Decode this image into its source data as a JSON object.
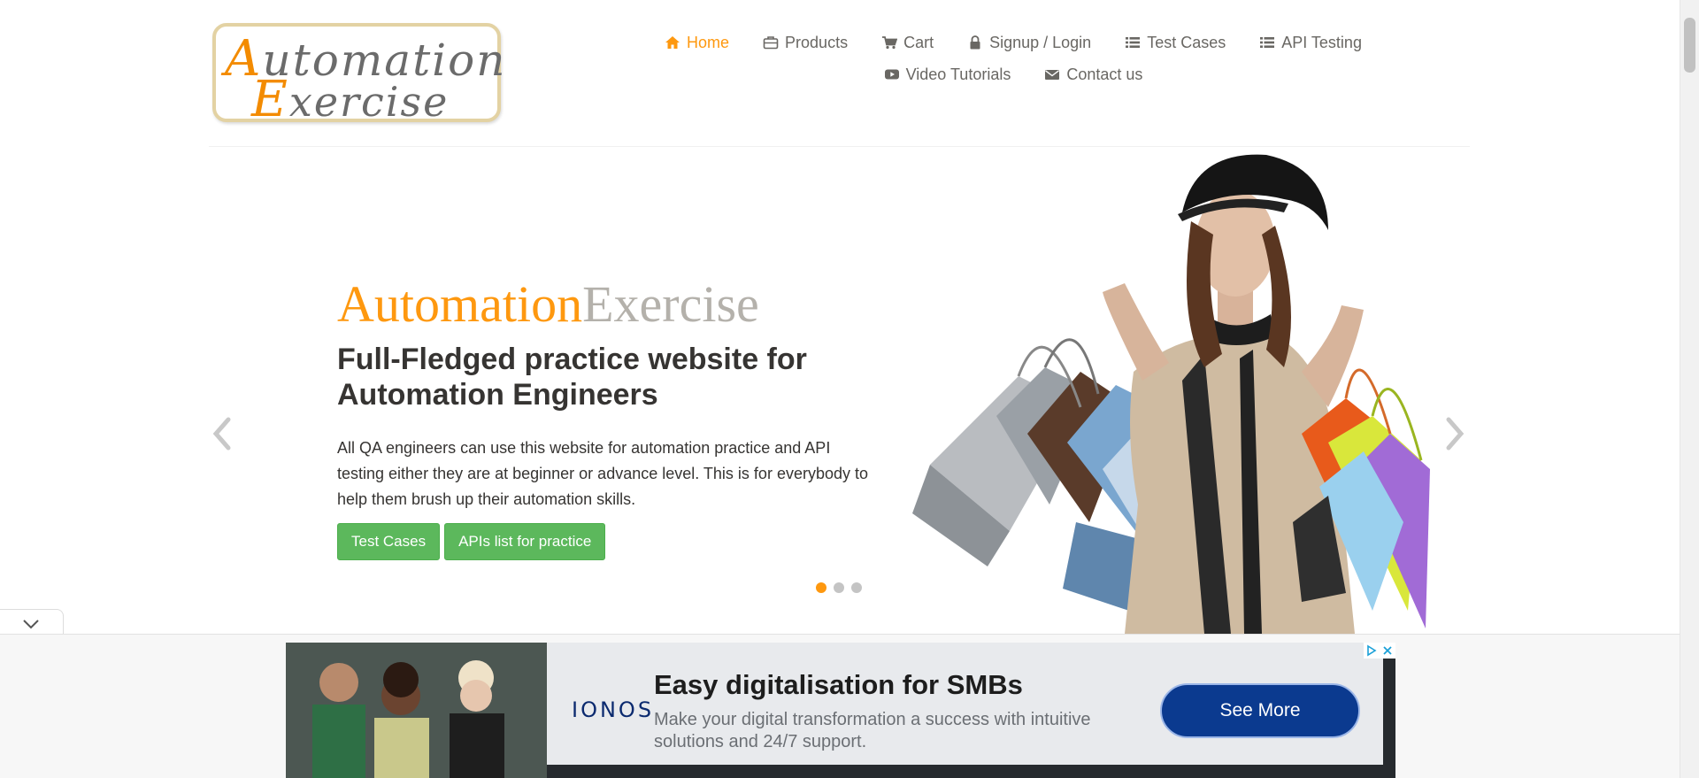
{
  "logo": {
    "line1_cap": "A",
    "line1_rest": "utomation",
    "line2_cap": "E",
    "line2_rest": "xercise"
  },
  "nav": {
    "row1": [
      {
        "label": "Home",
        "icon": "home-icon",
        "active": true
      },
      {
        "label": "Products",
        "icon": "briefcase-icon",
        "active": false
      },
      {
        "label": "Cart",
        "icon": "cart-icon",
        "active": false
      },
      {
        "label": "Signup / Login",
        "icon": "lock-icon",
        "active": false
      },
      {
        "label": "Test Cases",
        "icon": "list-icon",
        "active": false
      },
      {
        "label": "API Testing",
        "icon": "list-icon",
        "active": false
      }
    ],
    "row2": [
      {
        "label": "Video Tutorials",
        "icon": "youtube-play-icon",
        "active": false
      },
      {
        "label": "Contact us",
        "icon": "envelope-icon",
        "active": false
      }
    ]
  },
  "hero": {
    "brand_a": "Automation",
    "brand_b": "Exercise",
    "title": "Full-Fledged practice website for Automation Engineers",
    "text": "All QA engineers can use this website for automation practice and API testing either they are at beginner or advance level. This is for everybody to help them brush up their automation skills.",
    "buttons": [
      "Test Cases",
      "APIs list for practice"
    ],
    "slide_count": 3,
    "active_slide": 0
  },
  "ad": {
    "brand": "IONOS",
    "headline": "Easy digitalisation for SMBs",
    "sub": "Make your digital transformation a success with intuitive solutions and 24/7 support.",
    "cta": "See More"
  },
  "colors": {
    "accent": "#fe980f",
    "brand_gray": "#b4b1ab",
    "button_green": "#5cb85c",
    "ad_cta": "#0b3a8f"
  }
}
